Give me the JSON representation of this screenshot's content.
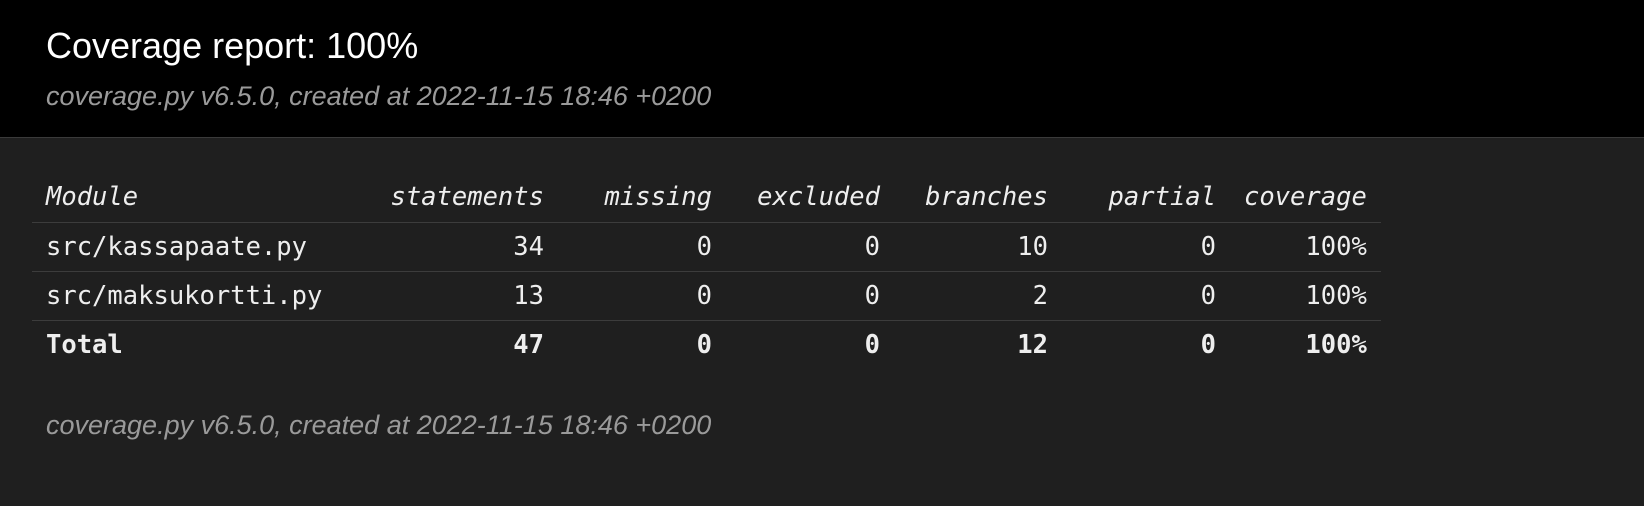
{
  "header": {
    "title": "Coverage report: 100%",
    "meta": "coverage.py v6.5.0, created at 2022-11-15 18:46 +0200"
  },
  "table": {
    "columns": [
      "Module",
      "statements",
      "missing",
      "excluded",
      "branches",
      "partial",
      "coverage"
    ],
    "rows": [
      {
        "module": "src/kassapaate.py",
        "statements": "34",
        "missing": "0",
        "excluded": "0",
        "branches": "10",
        "partial": "0",
        "coverage": "100%"
      },
      {
        "module": "src/maksukortti.py",
        "statements": "13",
        "missing": "0",
        "excluded": "0",
        "branches": "2",
        "partial": "0",
        "coverage": "100%"
      }
    ],
    "total": {
      "label": "Total",
      "statements": "47",
      "missing": "0",
      "excluded": "0",
      "branches": "12",
      "partial": "0",
      "coverage": "100%"
    }
  },
  "footer": {
    "meta": "coverage.py v6.5.0, created at 2022-11-15 18:46 +0200"
  },
  "colors": {
    "background": "#1f1f1f",
    "header_background": "#000000",
    "text": "#eeeeee",
    "muted_text": "#9a9a9a",
    "divider": "#3c3c3c"
  }
}
